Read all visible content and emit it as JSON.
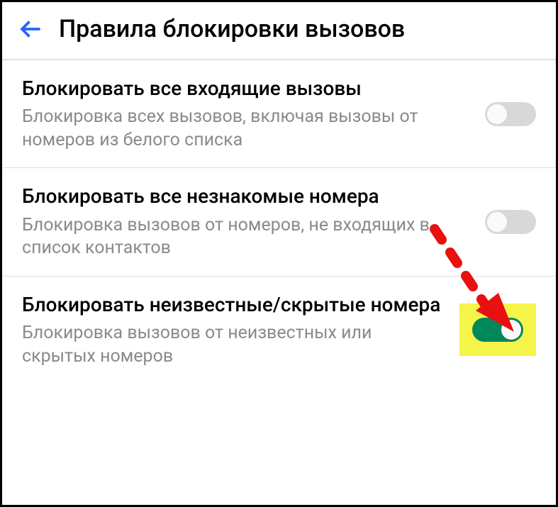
{
  "header": {
    "title": "Правила блокировки вызовов"
  },
  "settings": [
    {
      "title": "Блокировать все входящие вызовы",
      "description": "Блокировка всех вызовов, включая вызовы от номеров из белого списка",
      "enabled": false
    },
    {
      "title": "Блокировать все незнакомые номера",
      "description": "Блокировка вызовов от номеров, не входящих в список контактов",
      "enabled": false
    },
    {
      "title": "Блокировать неизвестные/скрытые номера",
      "description": "Блокировка вызовов от неизвестных или скрытых номеров",
      "enabled": true
    }
  ],
  "colors": {
    "arrow_accent": "#2962ff",
    "toggle_on": "#00875a",
    "toggle_off": "#d8d8d8",
    "highlight": "#f5f549",
    "annotation_arrow": "#e81010"
  }
}
